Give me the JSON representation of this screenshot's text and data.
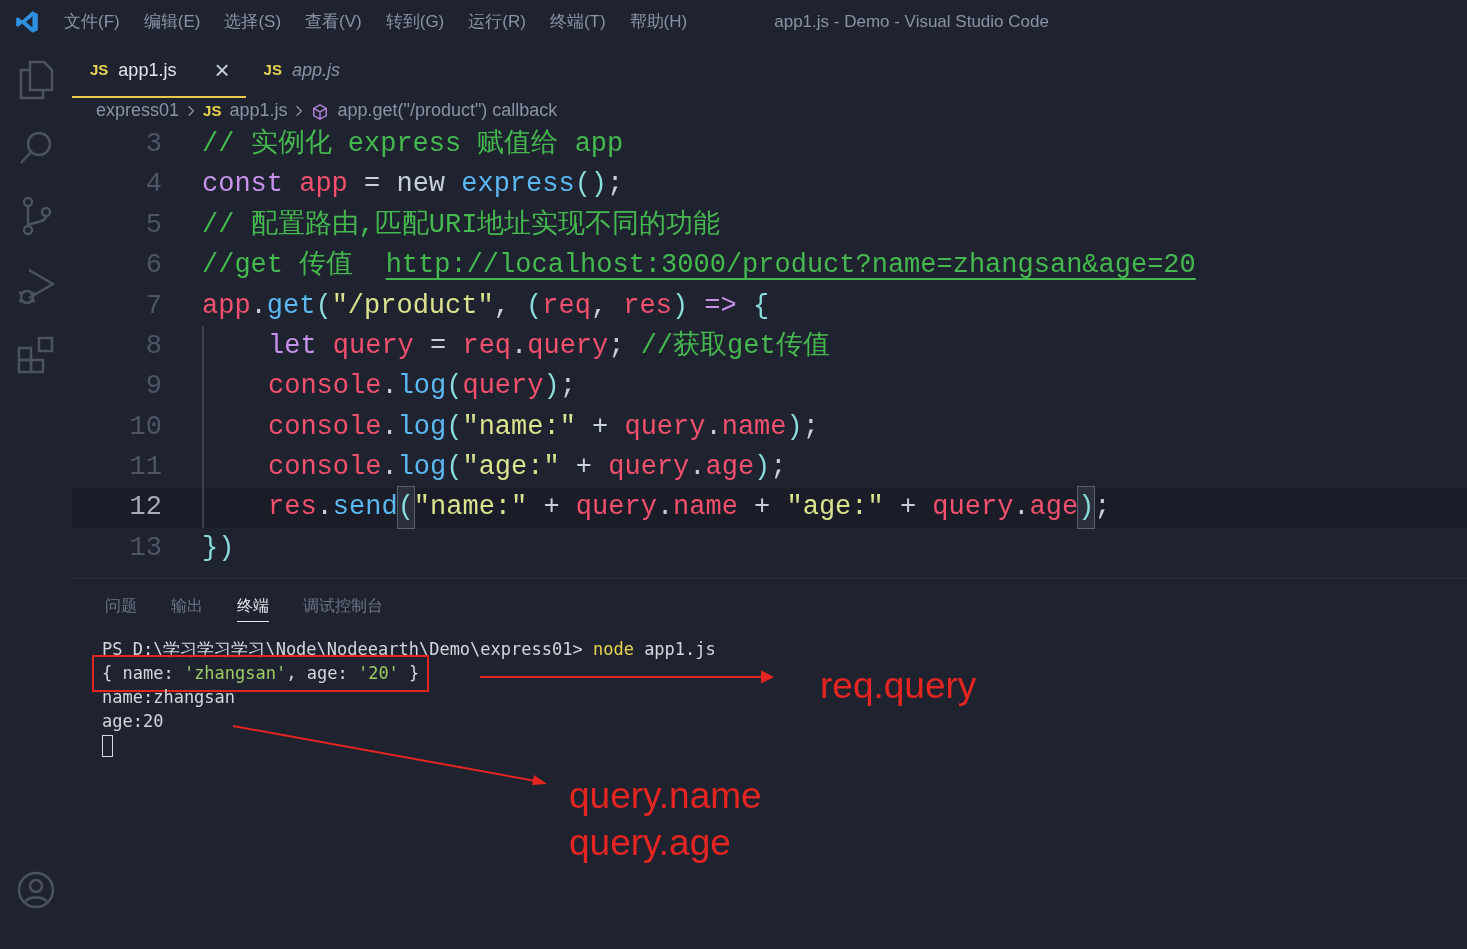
{
  "window": {
    "title": "app1.js - Demo - Visual Studio Code"
  },
  "menu": [
    "文件(F)",
    "编辑(E)",
    "选择(S)",
    "查看(V)",
    "转到(G)",
    "运行(R)",
    "终端(T)",
    "帮助(H)"
  ],
  "editor_tabs": [
    {
      "badge": "JS",
      "label": "app1.js",
      "selected": true,
      "preview": false,
      "close": "×"
    },
    {
      "badge": "JS",
      "label": "app.js",
      "selected": false,
      "preview": true
    }
  ],
  "breadcrumbs": [
    {
      "kind": "folder",
      "label": "express01"
    },
    {
      "kind": "file",
      "badge": "JS",
      "label": "app1.js"
    },
    {
      "kind": "symbol",
      "label": "app.get(\"/product\") callback"
    }
  ],
  "code": [
    {
      "number": "3",
      "current": false,
      "indented": false,
      "tokens": [
        {
          "kind": "comment",
          "text": "// 实例化 express 赋值给 app"
        }
      ]
    },
    {
      "number": "4",
      "current": false,
      "indented": false,
      "tokens": [
        {
          "kind": "keyword",
          "text": "const"
        },
        {
          "kind": "variable",
          "text": " app"
        },
        {
          "kind": "text",
          "text": " = new "
        },
        {
          "kind": "function",
          "text": "express"
        },
        {
          "kind": "punct",
          "text": "()"
        },
        {
          "kind": "text",
          "text": ";"
        }
      ]
    },
    {
      "number": "5",
      "current": false,
      "indented": false,
      "tokens": [
        {
          "kind": "comment",
          "text": "// 配置路由,匹配URI地址实现不同的功能"
        }
      ]
    },
    {
      "number": "6",
      "current": false,
      "indented": false,
      "tokens": [
        {
          "kind": "comment",
          "text": "//get 传值  "
        },
        {
          "kind": "link",
          "text": "http://localhost:3000/product?name=zhangsan&age=20"
        }
      ]
    },
    {
      "number": "7",
      "current": false,
      "indented": false,
      "tokens": [
        {
          "kind": "variable",
          "text": "app"
        },
        {
          "kind": "text",
          "text": "."
        },
        {
          "kind": "function",
          "text": "get"
        },
        {
          "kind": "punct",
          "text": "("
        },
        {
          "kind": "string",
          "text": "\"/product\""
        },
        {
          "kind": "text",
          "text": ", "
        },
        {
          "kind": "punct",
          "text": "("
        },
        {
          "kind": "variable",
          "text": "req"
        },
        {
          "kind": "text",
          "text": ", "
        },
        {
          "kind": "variable",
          "text": "res"
        },
        {
          "kind": "punct",
          "text": ")"
        },
        {
          "kind": "keyword",
          "text": " =>"
        },
        {
          "kind": "punct",
          "text": " {"
        }
      ]
    },
    {
      "number": "8",
      "current": false,
      "indented": true,
      "tokens": [
        {
          "kind": "keyword",
          "text": "let"
        },
        {
          "kind": "variable",
          "text": " query"
        },
        {
          "kind": "text",
          "text": " = "
        },
        {
          "kind": "variable",
          "text": "req"
        },
        {
          "kind": "text",
          "text": "."
        },
        {
          "kind": "variable",
          "text": "query"
        },
        {
          "kind": "text",
          "text": "; "
        },
        {
          "kind": "comment",
          "text": "//获取get传值"
        }
      ]
    },
    {
      "number": "9",
      "current": false,
      "indented": true,
      "tokens": [
        {
          "kind": "variable",
          "text": "console"
        },
        {
          "kind": "text",
          "text": "."
        },
        {
          "kind": "function",
          "text": "log"
        },
        {
          "kind": "punct",
          "text": "("
        },
        {
          "kind": "variable",
          "text": "query"
        },
        {
          "kind": "punct",
          "text": ")"
        },
        {
          "kind": "text",
          "text": ";"
        }
      ]
    },
    {
      "number": "10",
      "current": false,
      "indented": true,
      "tokens": [
        {
          "kind": "variable",
          "text": "console"
        },
        {
          "kind": "text",
          "text": "."
        },
        {
          "kind": "function",
          "text": "log"
        },
        {
          "kind": "punct",
          "text": "("
        },
        {
          "kind": "string",
          "text": "\"name:\""
        },
        {
          "kind": "text",
          "text": " + "
        },
        {
          "kind": "variable",
          "text": "query"
        },
        {
          "kind": "text",
          "text": "."
        },
        {
          "kind": "variable",
          "text": "name"
        },
        {
          "kind": "punct",
          "text": ")"
        },
        {
          "kind": "text",
          "text": ";"
        }
      ]
    },
    {
      "number": "11",
      "current": false,
      "indented": true,
      "tokens": [
        {
          "kind": "variable",
          "text": "console"
        },
        {
          "kind": "text",
          "text": "."
        },
        {
          "kind": "function",
          "text": "log"
        },
        {
          "kind": "punct",
          "text": "("
        },
        {
          "kind": "string",
          "text": "\"age:\""
        },
        {
          "kind": "text",
          "text": " + "
        },
        {
          "kind": "variable",
          "text": "query"
        },
        {
          "kind": "text",
          "text": "."
        },
        {
          "kind": "variable",
          "text": "age"
        },
        {
          "kind": "punct",
          "text": ")"
        },
        {
          "kind": "text",
          "text": ";"
        }
      ]
    },
    {
      "number": "12",
      "current": true,
      "indented": true,
      "tokens": [
        {
          "kind": "variable",
          "text": "res"
        },
        {
          "kind": "text",
          "text": "."
        },
        {
          "kind": "function",
          "text": "send"
        },
        {
          "kind": "matched",
          "text": "("
        },
        {
          "kind": "string",
          "text": "\"name:\""
        },
        {
          "kind": "text",
          "text": " + "
        },
        {
          "kind": "variable",
          "text": "query"
        },
        {
          "kind": "text",
          "text": "."
        },
        {
          "kind": "variable",
          "text": "name"
        },
        {
          "kind": "text",
          "text": " + "
        },
        {
          "kind": "string",
          "text": "\"age:\""
        },
        {
          "kind": "text",
          "text": " + "
        },
        {
          "kind": "variable",
          "text": "query"
        },
        {
          "kind": "text",
          "text": "."
        },
        {
          "kind": "variable",
          "text": "age"
        },
        {
          "kind": "matched",
          "text": ")"
        },
        {
          "kind": "text",
          "text": ";"
        }
      ]
    },
    {
      "number": "13",
      "current": false,
      "indented": false,
      "tokens": [
        {
          "kind": "punct",
          "text": "})"
        }
      ]
    }
  ],
  "panel_tabs": [
    {
      "label": "问题",
      "selected": false
    },
    {
      "label": "输出",
      "selected": false
    },
    {
      "label": "终端",
      "selected": true
    },
    {
      "label": "调试控制台",
      "selected": false
    }
  ],
  "terminal": {
    "lines": [
      {
        "boxed": false,
        "tokens": [
          {
            "kind": "text",
            "text": "PS D:\\学习学习学习\\Node\\Nodeearth\\Demo\\express01> "
          },
          {
            "kind": "command",
            "text": "node"
          },
          {
            "kind": "text",
            "text": " app1.js"
          }
        ]
      },
      {
        "boxed": true,
        "tokens": [
          {
            "kind": "text",
            "text": "{ name: "
          },
          {
            "kind": "string",
            "text": "'zhangsan'"
          },
          {
            "kind": "text",
            "text": ", age: "
          },
          {
            "kind": "string",
            "text": "'20'"
          },
          {
            "kind": "text",
            "text": " }"
          }
        ]
      },
      {
        "boxed": false,
        "tokens": [
          {
            "kind": "text",
            "text": "name:zhangsan"
          }
        ]
      },
      {
        "boxed": false,
        "tokens": [
          {
            "kind": "text",
            "text": "age:20"
          }
        ]
      }
    ],
    "cursor": true
  },
  "annotations": {
    "labels": [
      "req.query",
      "query.name",
      "query.age"
    ]
  }
}
